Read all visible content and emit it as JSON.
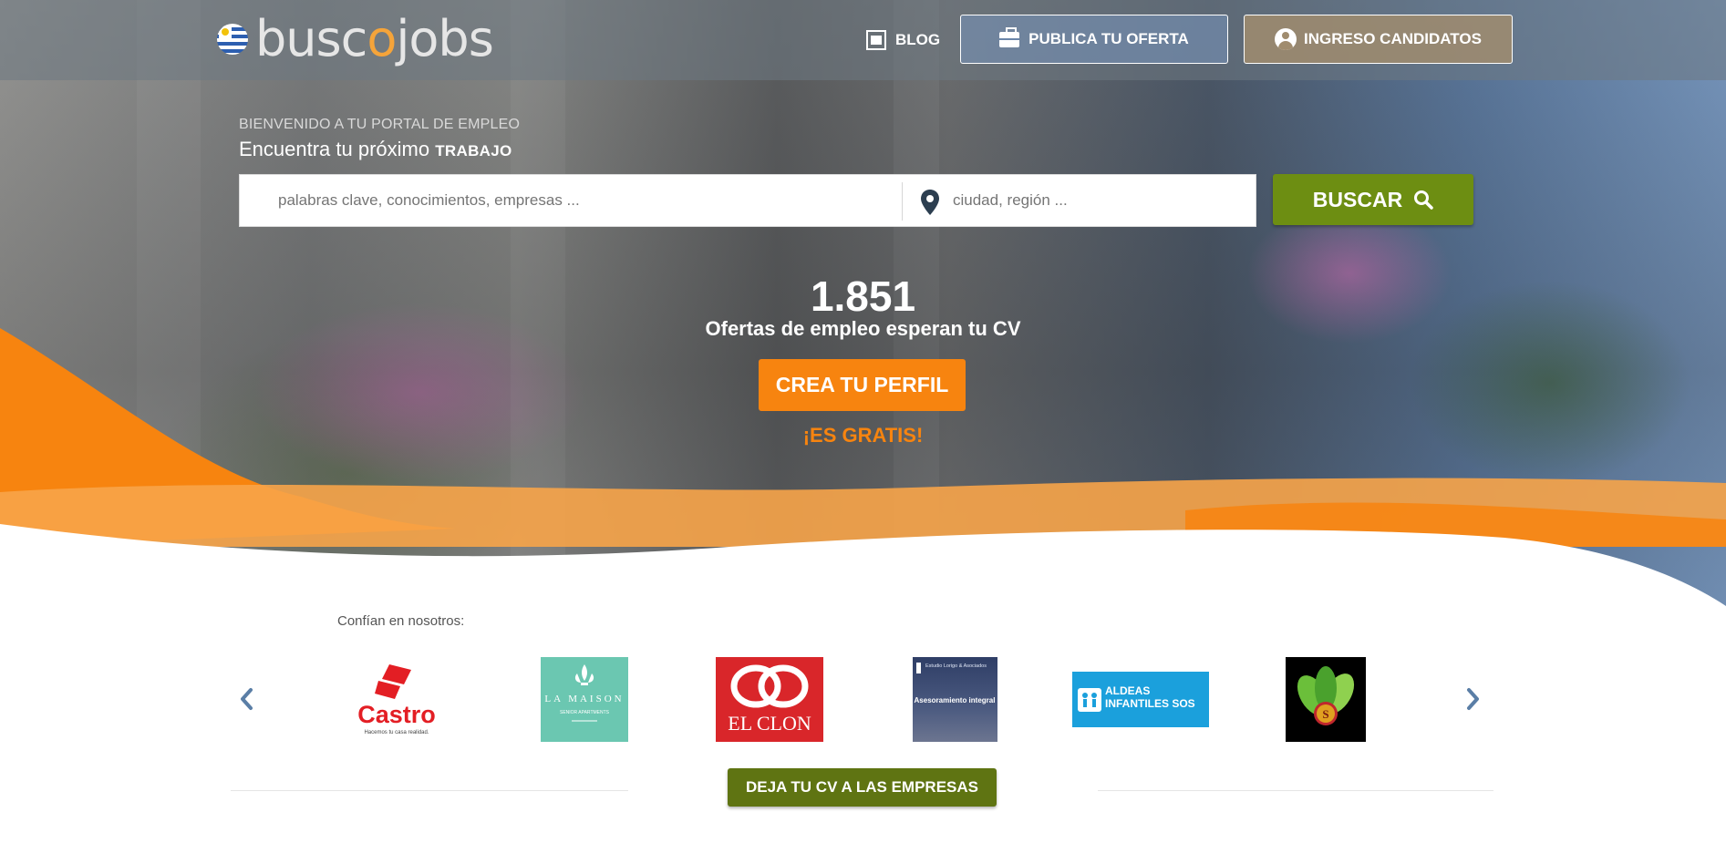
{
  "header": {
    "logo_text_a": "busc",
    "logo_text_o": "o",
    "logo_text_b": "jobs",
    "blog_label": "BLOG",
    "publica_label": "PUBLICA TU OFERTA",
    "ingreso_label": "INGRESO CANDIDATOS"
  },
  "hero": {
    "welcome": "BIENVENIDO A TU PORTAL DE EMPLEO",
    "headline_prefix": "Encuentra tu próximo",
    "headline_emphasis": "TRABAJO",
    "search": {
      "keywords_placeholder": "palabras clave, conocimientos, empresas ...",
      "location_placeholder": "ciudad, región ...",
      "button_label": "BUSCAR"
    },
    "offers_count": "1.851",
    "offers_text": "Ofertas de empleo esperan tu CV",
    "cta_label": "CREA TU PERFIL",
    "free_text": "¡ES GRATIS!"
  },
  "partners": {
    "heading": "Confían en nosotros:",
    "logos": [
      {
        "name": "Castro",
        "tagline": "Hacemos tu casa realidad."
      },
      {
        "name": "LA MAISON",
        "tagline": "SENIOR APARTMENTS"
      },
      {
        "name": "EL CLON"
      },
      {
        "name": "Estudio Lorigo & Asociados",
        "tagline": "Asesoramiento integral"
      },
      {
        "name": "ALDEAS INFANTILES SOS"
      },
      {
        "name": "S"
      }
    ],
    "cta_label": "DEJA TU CV A LAS EMPRESAS"
  },
  "colors": {
    "accent_orange": "#f7840f",
    "accent_green": "#6d8e12",
    "dark_green": "#5f7412"
  },
  "icons": [
    "uruguay-flag-icon",
    "blog-icon",
    "briefcase-icon",
    "user-circle-icon",
    "map-pin-icon",
    "search-icon",
    "chevron-left-icon",
    "chevron-right-icon"
  ]
}
